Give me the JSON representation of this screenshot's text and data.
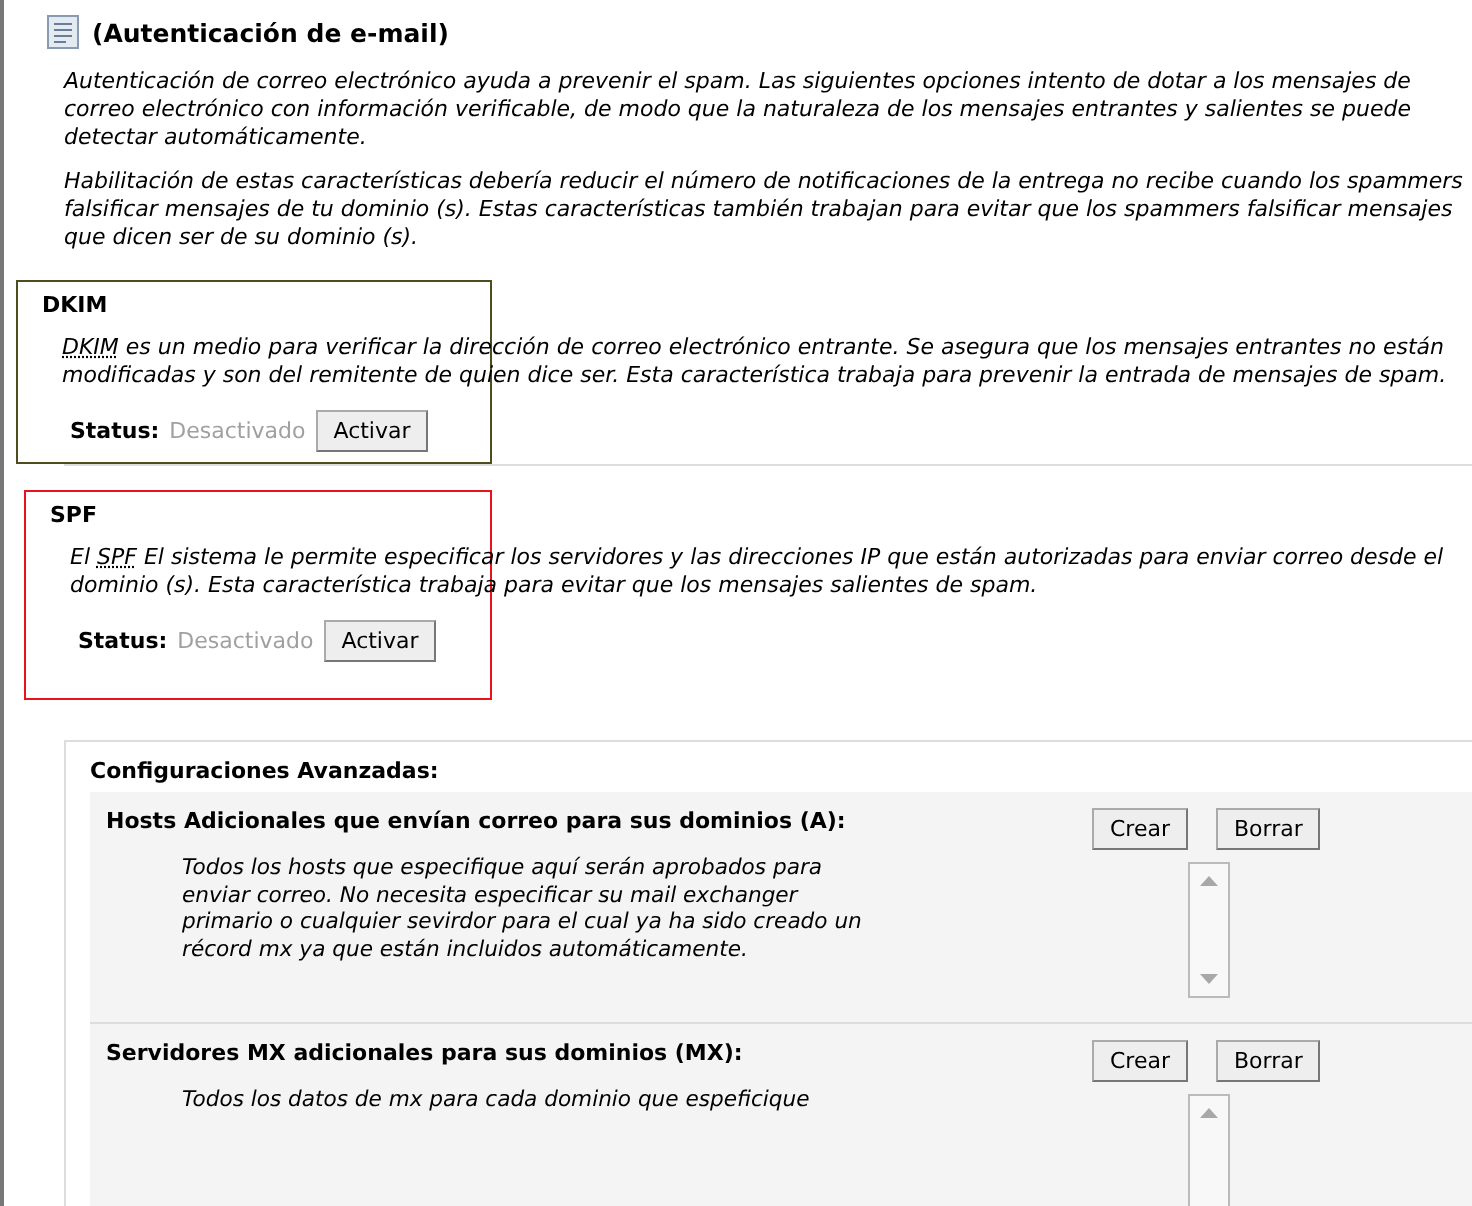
{
  "header": {
    "title": "(Autenticación de e-mail)"
  },
  "intro": [
    "Autenticación de correo electrónico ayuda a prevenir el spam. Las siguientes opciones intento de dotar a los mensajes de correo electrónico con información verificable, de modo que la naturaleza de los mensajes entrantes y salientes se puede detectar automáticamente.",
    "Habilitación de estas características debería reducir el número de notificaciones de la entrega no recibe cuando los spammers falsificar mensajes de tu dominio (s). Estas características también trabajan para evitar que los spammers falsificar mensajes que dicen ser de su dominio (s)."
  ],
  "features": [
    {
      "title": "DKIM",
      "term": "DKIM",
      "text": " es un medio para verificar la dirección de correo electrónico entrante. Se asegura que los mensajes entrantes no están modificadas y son del remitente de quien dice ser. Esta característica trabaja para prevenir la entrada de mensajes de spam.",
      "status_label": "Status:",
      "status": "Desactivado",
      "enabled": false,
      "button": "Activar",
      "color": "#4d4d1f"
    },
    {
      "title": "SPF",
      "lead": "El ",
      "term": "SPF",
      "text": " El sistema le permite especificar los servidores y las direcciones IP que están autorizadas para enviar correo desde el dominio (s). Esta característica trabaja para evitar que los mensajes salientes de spam.",
      "status_label": "Status:",
      "status": "Desactivado",
      "enabled": false,
      "button": "Activar",
      "color": "#e8141c"
    }
  ],
  "advanced": {
    "title": "Configuraciones Avanzadas:",
    "sections": [
      {
        "title": "Hosts Adicionales que envían correo para sus dominios (A):",
        "text": "Todos los hosts que especifique aquí serán aprobados para enviar correo. No necesita especificar su mail exchanger primario o cualquier sevirdor para el cual ya ha sido creado un récord mx ya que están incluidos automáticamente.",
        "buttons": [
          "Crear",
          "Borrar"
        ]
      },
      {
        "title": "Servidores MX adicionales para sus dominios (MX):",
        "text": "Todos los datos de mx para cada dominio que espeficique",
        "buttons": [
          "Crear",
          "Borrar"
        ]
      }
    ]
  }
}
